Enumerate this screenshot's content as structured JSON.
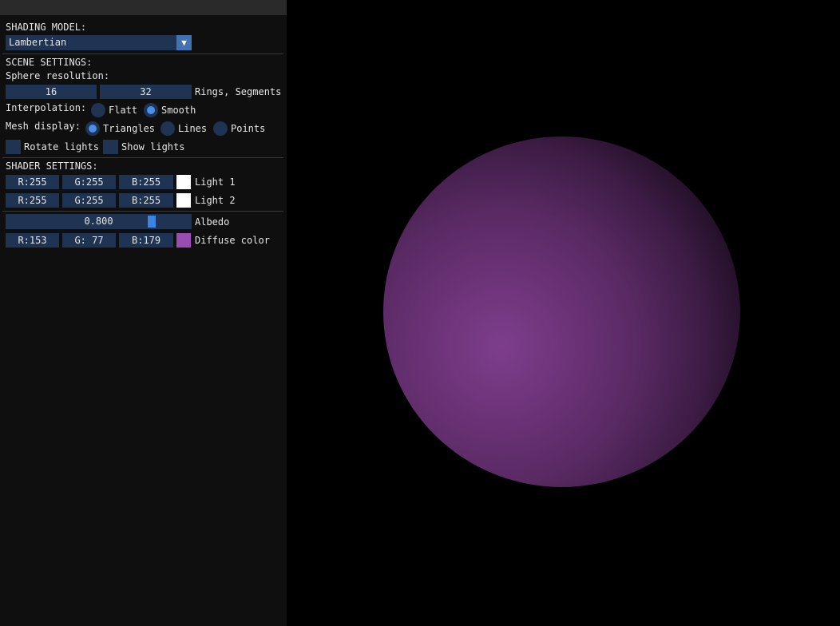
{
  "shading": {
    "title": "SHADING MODEL:",
    "selected": "Lambertian",
    "arrow": "▼"
  },
  "scene": {
    "title": "SCENE SETTINGS:",
    "sphere_resolution_label": "Sphere resolution:",
    "rings": "16",
    "segments": "32",
    "resolution_suffix": "Rings, Segments",
    "interpolation_label": "Interpolation:",
    "interp_options": [
      "Flatt",
      "Smooth"
    ],
    "interp_selected": "Smooth",
    "mesh_label": "Mesh display:",
    "mesh_options": [
      "Triangles",
      "Lines",
      "Points"
    ],
    "mesh_selected": "Triangles",
    "rotate_lights": {
      "label": "Rotate lights",
      "checked": false
    },
    "show_lights": {
      "label": "Show lights",
      "checked": false
    }
  },
  "shader": {
    "title": "SHADER SETTINGS:",
    "light1": {
      "r": "R:255",
      "g": "G:255",
      "b": "B:255",
      "label": "Light 1",
      "color": "#ffffff"
    },
    "light2": {
      "r": "R:255",
      "g": "G:255",
      "b": "B:255",
      "label": "Light 2",
      "color": "#ffffff"
    },
    "albedo": {
      "value_text": "0.800",
      "value": 0.8,
      "label": "Albedo"
    },
    "diffuse": {
      "r": "R:153",
      "g": "G: 77",
      "b": "B:179",
      "label": "Diffuse color",
      "color": "#994db3"
    }
  },
  "colors": {
    "accent": "#4272b3",
    "radio_active": "#4a90ea",
    "slider_grab": "#3d84e0",
    "field_bg": "#1f3352",
    "panel_bg": "#0f0f0f",
    "sphere": "#7d3d8b"
  }
}
